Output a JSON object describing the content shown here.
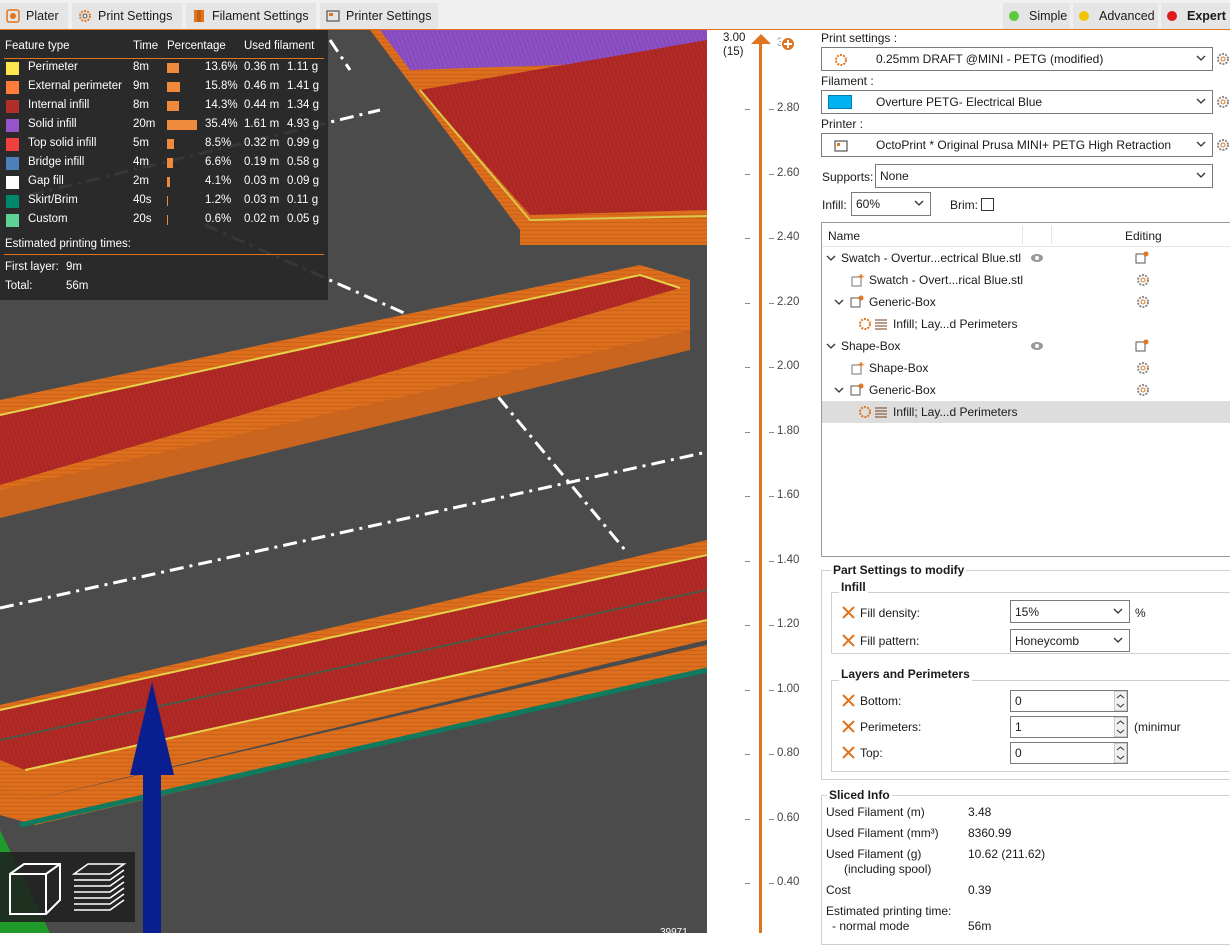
{
  "tabs": [
    {
      "label": "Plater",
      "icon": "plater-icon"
    },
    {
      "label": "Print Settings",
      "icon": "print-settings-gear-icon"
    },
    {
      "label": "Filament Settings",
      "icon": "filament-spool-icon"
    },
    {
      "label": "Printer Settings",
      "icon": "printer-icon"
    }
  ],
  "modes": [
    {
      "label": "Simple",
      "color": "#5fc93c"
    },
    {
      "label": "Advanced",
      "color": "#f2c400"
    },
    {
      "label": "Expert",
      "color": "#e0191a"
    }
  ],
  "legend": {
    "headers": {
      "feature": "Feature type",
      "time": "Time",
      "percentage": "Percentage",
      "filament": "Used filament"
    },
    "rows": [
      {
        "name": "Perimeter",
        "color": "#ffe64d",
        "time": "8m",
        "pct": "13.6%",
        "pct_value": 13.6,
        "len": "0.36 m",
        "weight": "1.11 g"
      },
      {
        "name": "External perimeter",
        "color": "#ff7d38",
        "time": "9m",
        "pct": "15.8%",
        "pct_value": 15.8,
        "len": "0.46 m",
        "weight": "1.41 g"
      },
      {
        "name": "Internal infill",
        "color": "#b03029",
        "time": "8m",
        "pct": "14.3%",
        "pct_value": 14.3,
        "len": "0.44 m",
        "weight": "1.34 g"
      },
      {
        "name": "Solid infill",
        "color": "#9654cc",
        "time": "20m",
        "pct": "35.4%",
        "pct_value": 35.4,
        "len": "1.61 m",
        "weight": "4.93 g"
      },
      {
        "name": "Top solid infill",
        "color": "#f04040",
        "time": "5m",
        "pct": "8.5%",
        "pct_value": 8.5,
        "len": "0.32 m",
        "weight": "0.99 g"
      },
      {
        "name": "Bridge infill",
        "color": "#4d80ba",
        "time": "4m",
        "pct": "6.6%",
        "pct_value": 6.6,
        "len": "0.19 m",
        "weight": "0.58 g"
      },
      {
        "name": "Gap fill",
        "color": "#ffffff",
        "time": "2m",
        "pct": "4.1%",
        "pct_value": 4.1,
        "len": "0.03 m",
        "weight": "0.09 g"
      },
      {
        "name": "Skirt/Brim",
        "color": "#00876e",
        "time": "40s",
        "pct": "1.2%",
        "pct_value": 1.2,
        "len": "0.03 m",
        "weight": "0.11 g"
      },
      {
        "name": "Custom",
        "color": "#5ed194",
        "time": "20s",
        "pct": "0.6%",
        "pct_value": 0.6,
        "len": "0.02 m",
        "weight": "0.05 g"
      }
    ],
    "times_title": "Estimated printing times:",
    "first_layer_label": "First layer:",
    "first_layer_value": "9m",
    "total_label": "Total:",
    "total_value": "56m"
  },
  "viewport": {
    "bottom_readout": "39971",
    "view_buttons": [
      "iso-view-cube-icon",
      "layers-view-icon"
    ]
  },
  "layer_slider": {
    "top_value": "3.00",
    "top_layer": "(15)",
    "ticks": [
      "2.80",
      "2.60",
      "2.40",
      "2.20",
      "2.00",
      "1.80",
      "1.60",
      "1.40",
      "1.20",
      "1.00",
      "0.80",
      "0.60",
      "0.40"
    ],
    "accent": "#e07520"
  },
  "panel": {
    "print_settings_label": "Print settings :",
    "print_settings_value": "0.25mm DRAFT @MINI - PETG (modified)",
    "filament_label": "Filament :",
    "filament_value": "Overture PETG- Electrical Blue",
    "filament_color": "#00b2f0",
    "printer_label": "Printer :",
    "printer_value": "OctoPrint * Original Prusa MINI+ PETG High Retraction",
    "supports_label": "Supports:",
    "supports_value": "None",
    "infill_label": "Infill:",
    "infill_value": "60%",
    "brim_label": "Brim:",
    "tree_headers": {
      "name": "Name",
      "editing": "Editing"
    },
    "tree_rows": [
      {
        "label": "Swatch - Overtur...ectrical Blue.stl",
        "kind": "object"
      },
      {
        "label": "Swatch - Overt...rical Blue.stl",
        "kind": "part"
      },
      {
        "label": "Generic-Box",
        "kind": "modifier"
      },
      {
        "label": "Infill; Lay...d Perimeters",
        "kind": "settings"
      },
      {
        "label": "Shape-Box",
        "kind": "object"
      },
      {
        "label": "Shape-Box",
        "kind": "part"
      },
      {
        "label": "Generic-Box",
        "kind": "modifier"
      },
      {
        "label": "Infill; Lay...d Perimeters",
        "kind": "settings",
        "selected": true
      }
    ],
    "part_settings_title": "Part Settings to modify",
    "infill_group": "Infill",
    "fill_density_label": "Fill density:",
    "fill_density_value": "15%",
    "fill_density_unit": "%",
    "fill_pattern_label": "Fill pattern:",
    "fill_pattern_value": "Honeycomb",
    "layers_group": "Layers and Perimeters",
    "bottom_label": "Bottom:",
    "bottom_value": "0",
    "perimeters_label": "Perimeters:",
    "perimeters_value": "1",
    "perimeters_note": "(minimur",
    "top_label": "Top:",
    "top_value": "0",
    "sliced_title": "Sliced Info",
    "sliced_rows": [
      {
        "label": "Used Filament (m)",
        "value": "3.48"
      },
      {
        "label": "Used Filament (mm³)",
        "value": "8360.99"
      },
      {
        "label": "Used Filament (g)",
        "value": "10.62 (211.62)"
      },
      {
        "label": "(including spool)",
        "value": ""
      },
      {
        "label": "Cost",
        "value": "0.39"
      },
      {
        "label": "Estimated printing time:",
        "value": ""
      },
      {
        "label": "- normal mode",
        "value": "56m"
      }
    ]
  }
}
